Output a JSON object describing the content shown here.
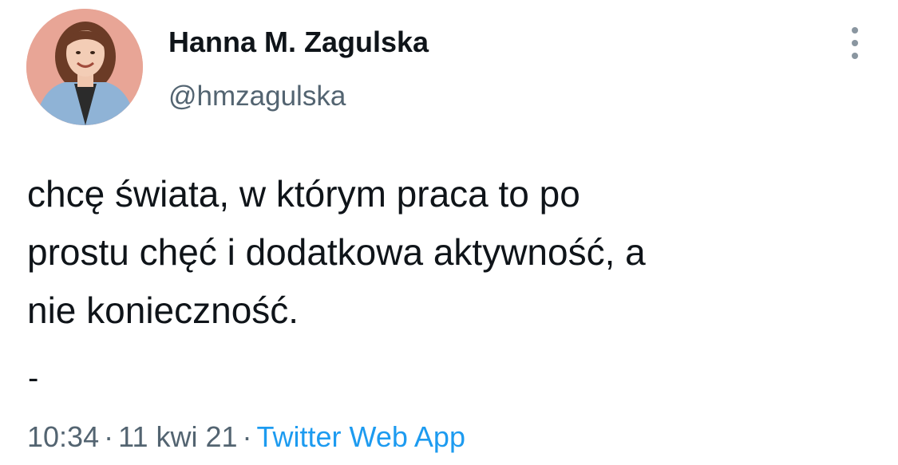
{
  "author": {
    "display_name": "Hanna M. Zagulska",
    "handle": "@hmzagulska"
  },
  "tweet": {
    "text_lines": [
      "chcę świata, w którym praca to po",
      "prostu chęć i dodatkowa aktywność, a",
      "nie konieczność."
    ],
    "dash": "-"
  },
  "meta": {
    "time": "10:34",
    "separator": "·",
    "date": "11 kwi 21",
    "source": "Twitter Web App"
  },
  "icons": {
    "more": "more-vertical-icon"
  },
  "colors": {
    "secondary_text": "#536471",
    "link": "#1d9bf0",
    "primary_text": "#0f1419",
    "avatar_bg": "#e8a596"
  }
}
